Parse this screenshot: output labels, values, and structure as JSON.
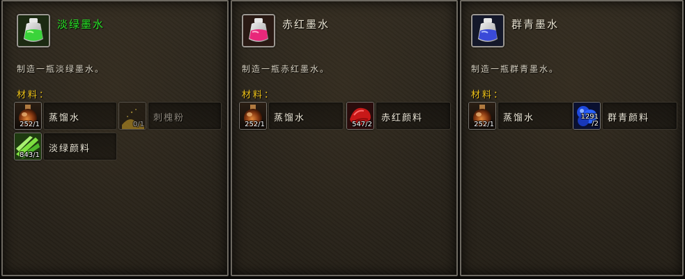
{
  "panels": [
    {
      "title": "淡绿墨水",
      "description": "制造一瓶淡绿墨水。",
      "materials_label": "材料：",
      "icon": "light-green-ink-bottle-icon",
      "reagents": [
        {
          "name": "蒸馏水",
          "count": "252/1",
          "icon": "distilled-water-flask-icon",
          "available": true
        },
        {
          "name": "刺槐粉",
          "count": "0/1",
          "icon": "powder-pile-icon",
          "available": false
        },
        {
          "name": "淡绿颜料",
          "count": "843/1",
          "icon": "green-pigment-icon",
          "available": true
        }
      ]
    },
    {
      "title": "赤红墨水",
      "description": "制造一瓶赤红墨水。",
      "materials_label": "材料：",
      "icon": "red-ink-bottle-icon",
      "reagents": [
        {
          "name": "蒸馏水",
          "count": "252/1",
          "icon": "distilled-water-flask-icon",
          "available": true
        },
        {
          "name": "赤红颜料",
          "count": "547/2",
          "icon": "red-pigment-icon",
          "available": true
        }
      ]
    },
    {
      "title": "群青墨水",
      "description": "制造一瓶群青墨水。",
      "materials_label": "材料：",
      "icon": "blue-ink-bottle-icon",
      "reagents": [
        {
          "name": "蒸馏水",
          "count": "252/1",
          "icon": "distilled-water-flask-icon",
          "available": true
        },
        {
          "name": "群青颜料",
          "count": "1291\n/2",
          "icon": "blue-pigment-icon",
          "available": true
        }
      ]
    }
  ],
  "colors": {
    "title_green": "#25e325",
    "title_default": "#e8e2d0",
    "materials_label": "#f0c419",
    "reagent_unavailable": "#8b857a"
  }
}
